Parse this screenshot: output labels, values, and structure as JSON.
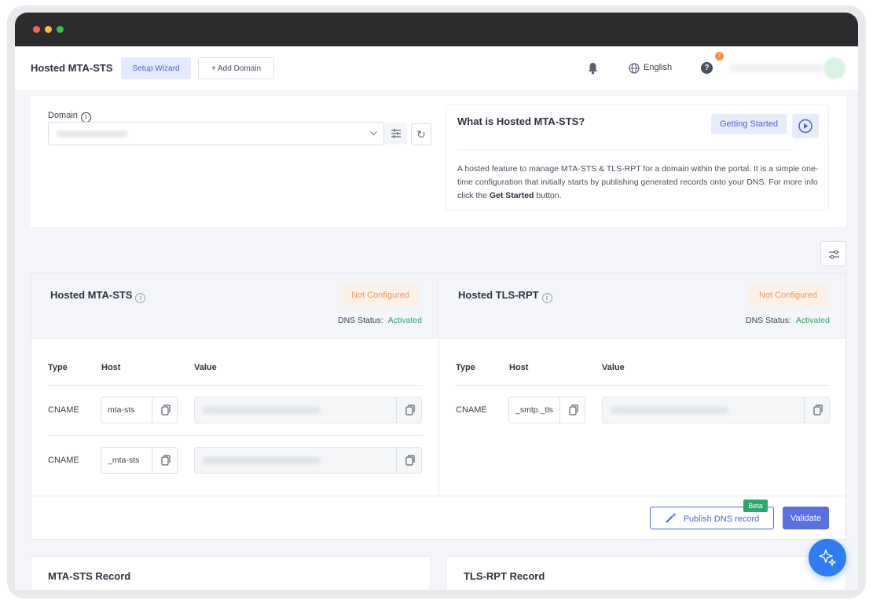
{
  "window": {
    "dots": [
      "#ff5f57",
      "#febc2e",
      "#28c840"
    ]
  },
  "topnav": {
    "title": "Hosted MTA-STS",
    "setup_wizard": "Setup Wizard",
    "add_domain": "+ Add Domain",
    "language": "English",
    "help_badge": "7"
  },
  "domain": {
    "label": "Domain",
    "info_icon": "i"
  },
  "info_card": {
    "title": "What is Hosted MTA-STS?",
    "getting_started": "Getting Started",
    "desc_part1": "A hosted feature to manage MTA-STS & TLS-RPT for a domain within the portal. It is a simple one-time configuration that initially starts by publishing generated records onto your DNS. For more info click the ",
    "desc_bold": "Get Started",
    "desc_part2": " button."
  },
  "mta_sts": {
    "title": "Hosted MTA-STS",
    "badge": "Not Configured",
    "dns_status_label": "DNS Status:",
    "dns_status_value": "Activated",
    "columns": {
      "type": "Type",
      "host": "Host",
      "value": "Value"
    },
    "rows": [
      {
        "type": "CNAME",
        "host": "mta-sts"
      },
      {
        "type": "CNAME",
        "host": "_mta-sts"
      }
    ]
  },
  "tls_rpt": {
    "title": "Hosted TLS-RPT",
    "badge": "Not Configured",
    "dns_status_label": "DNS Status:",
    "dns_status_value": "Activated",
    "columns": {
      "type": "Type",
      "host": "Host",
      "value": "Value"
    },
    "rows": [
      {
        "type": "CNAME",
        "host": "_smtp._tls"
      }
    ]
  },
  "actions": {
    "publish": "Publish DNS record",
    "beta": "Beta",
    "validate": "Validate"
  },
  "records": {
    "mta_sts_record": "MTA-STS Record",
    "tls_rpt_record": "TLS-RPT Record"
  },
  "colors": {
    "accent": "#4a67d6",
    "success": "#2aa76d",
    "warning": "#f0995a"
  }
}
